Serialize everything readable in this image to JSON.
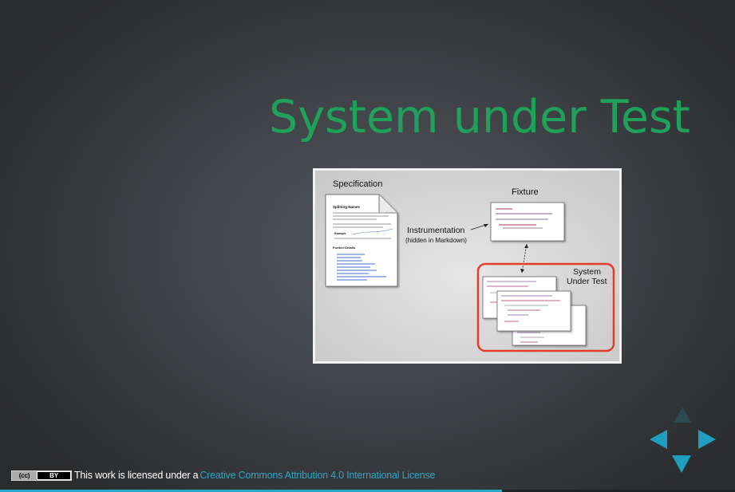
{
  "slide": {
    "title": "System under Test"
  },
  "diagram": {
    "specification_label": "Specification",
    "doc_heading": "Splitting Names",
    "doc_example_label": "Example",
    "doc_further_label": "Further Details",
    "fixture_label": "Fixture",
    "instrumentation_label": "Instrumentation",
    "instrumentation_sub": "(hidden in Markdown)",
    "sut_label_line1": "System",
    "sut_label_line2": "Under Test",
    "highlight_color": "#e53c2a"
  },
  "license": {
    "badge_left": "(cc)",
    "badge_right": "BY",
    "text": "This work is licensed under a",
    "link_text": "Creative Commons Attribution 4.0 International License"
  },
  "navigation": {
    "up_enabled": false,
    "left_enabled": true,
    "right_enabled": true,
    "down_enabled": true,
    "accent_color": "#1f9ebf"
  },
  "progress": {
    "fraction": 0.683
  }
}
